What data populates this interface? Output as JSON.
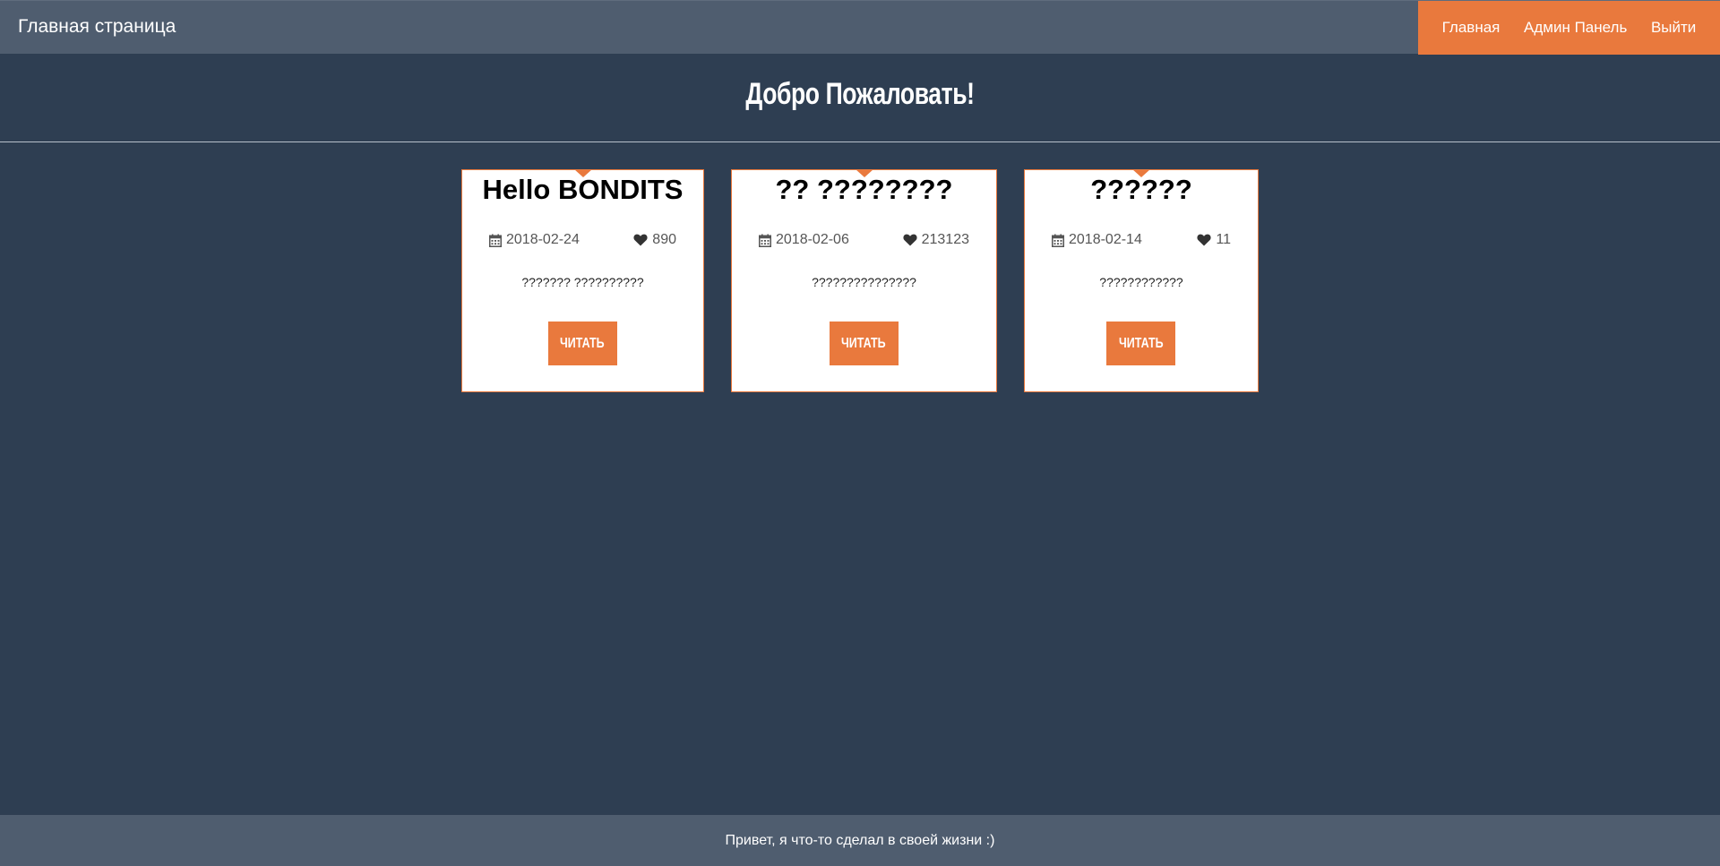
{
  "navbar": {
    "brand": "Главная страница",
    "links": [
      {
        "label": "Главная"
      },
      {
        "label": "Админ Панель"
      },
      {
        "label": "Выйти"
      }
    ],
    "background": "#4f5d6f",
    "accent": "#e9793d"
  },
  "hero": {
    "title": "Добро Пожаловать!"
  },
  "posts": [
    {
      "title": "Hello BONDITS",
      "date": "2018-02-24",
      "likes": "890",
      "excerpt": "??????? ??????????",
      "button_label": "ЧИТАТЬ",
      "date_icon": "calendar-icon",
      "likes_icon": "heart-icon"
    },
    {
      "title": "?? ????????",
      "date": "2018-02-06",
      "likes": "213123",
      "excerpt": "???????????????",
      "button_label": "ЧИТАТЬ",
      "date_icon": "calendar-icon",
      "likes_icon": "heart-icon"
    },
    {
      "title": "??????",
      "date": "2018-02-14",
      "likes": "11",
      "excerpt": "????????????",
      "button_label": "ЧИТАТЬ",
      "date_icon": "calendar-icon",
      "likes_icon": "heart-icon"
    }
  ],
  "footer": {
    "text": "Привет, я что-то сделал в своей жизни :)"
  },
  "colors": {
    "page_background": "#2e3e52",
    "accent": "#e9793d",
    "card_background": "#ffffff"
  }
}
